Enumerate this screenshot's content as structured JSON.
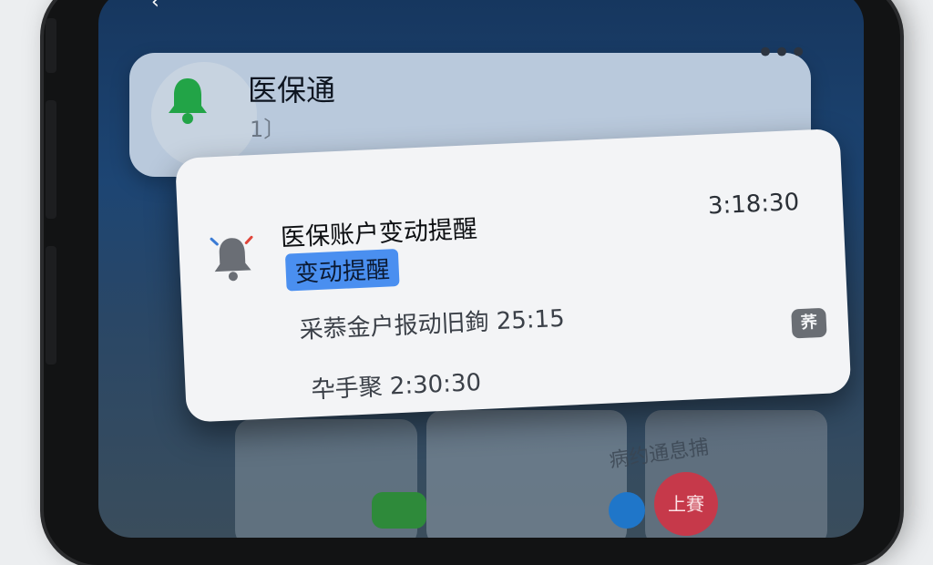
{
  "app_card": {
    "title": "医保通",
    "subtitle": "1〕",
    "more_label": "•••",
    "bell_color": "#22a447"
  },
  "notification": {
    "title": "医保账户变动提醒",
    "highlight": "变动提醒",
    "time": "3:18:30",
    "line1": "采菾金户报动旧銁 25:15",
    "line2": "卆手聚 2:30:30",
    "app_badge": "荞",
    "highlight_color": "#4a8ff0"
  },
  "background": {
    "tile_text": "病约通息捕",
    "heart_text": "上賽"
  }
}
